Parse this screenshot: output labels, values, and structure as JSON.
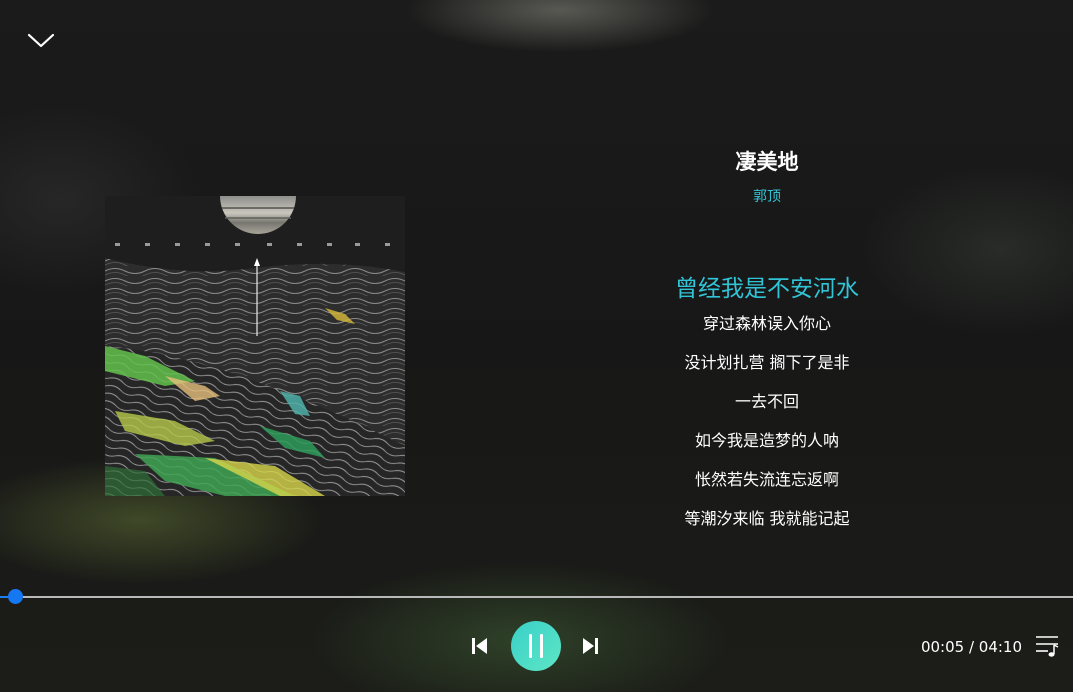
{
  "colors": {
    "accent": "#31c4d6",
    "progress": "#1f7ff0",
    "play_button": "#4ddbc7",
    "text": "#ffffff",
    "background": "#151515"
  },
  "header": {
    "collapse_icon": "chevron-down-icon"
  },
  "song": {
    "title": "凄美地",
    "artist": "郭顶",
    "cover_icon": "album-cover"
  },
  "lyrics": {
    "active_index": 0,
    "lines": [
      "曾经我是不安河水",
      "穿过森林误入你心",
      "没计划扎营 搁下了是非",
      "一去不回",
      "如今我是造梦的人呐",
      "怅然若失流连忘返啊",
      "等潮汐来临 我就能记起"
    ]
  },
  "player": {
    "progress_fraction": 0.014,
    "current_time": "00:05",
    "total_time": "04:10",
    "time_text": "00:05 / 04:10",
    "prev_icon": "skip-previous-icon",
    "play_state_icon": "pause-icon",
    "next_icon": "skip-next-icon",
    "playlist_icon": "playlist-icon"
  }
}
